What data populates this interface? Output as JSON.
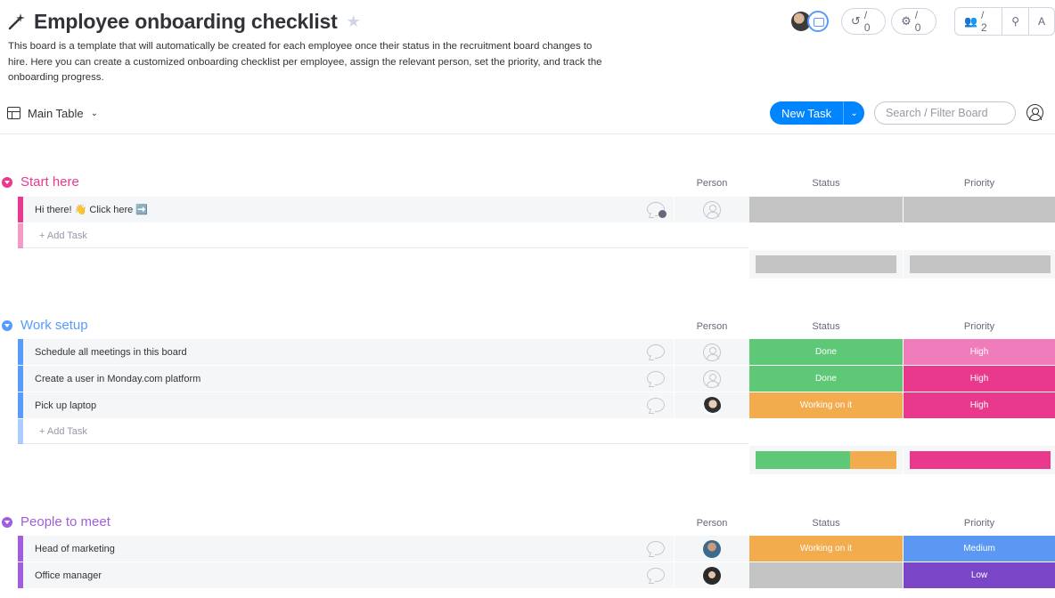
{
  "board": {
    "title": "Employee onboarding checklist",
    "description": "This board is a template that will automatically be created for each employee once their status in the recruitment board changes to hire. Here you can create a customized onboarding checklist per employee, assign the relevant person, set the priority, and track the onboarding progress."
  },
  "header_actions": {
    "activity_count": "/ 0",
    "automations_count": "/ 0",
    "members_count": "/ 2",
    "trailing_letter": "A"
  },
  "view": {
    "name": "Main Table",
    "new_task_label": "New Task",
    "search_placeholder": "Search / Filter Board"
  },
  "columns": {
    "person": "Person",
    "status": "Status",
    "priority": "Priority"
  },
  "add_task_placeholder": "+ Add Task",
  "colors": {
    "done": "#5ec877",
    "working": "#f2ac4e",
    "empty": "#c4c4c4",
    "high_light": "#f07cbc",
    "high": "#e8398c",
    "medium": "#5b98f4",
    "low": "#7b45c8",
    "group_start": "#e8398c",
    "group_work": "#579bfc",
    "group_people": "#a25ddc"
  },
  "groups": [
    {
      "title": "Start here",
      "items": [
        {
          "name": "Hi there! 👋 Click here ➡️",
          "status": "",
          "priority": ""
        }
      ]
    },
    {
      "title": "Work setup",
      "items": [
        {
          "name": "Schedule all meetings in this board",
          "status": "Done",
          "priority": "High"
        },
        {
          "name": "Create a user in Monday.com platform",
          "status": "Done",
          "priority": "High"
        },
        {
          "name": "Pick up laptop",
          "status": "Working on it",
          "priority": "High"
        }
      ]
    },
    {
      "title": "People to meet",
      "items": [
        {
          "name": "Head of marketing",
          "status": "Working on it",
          "priority": "Medium"
        },
        {
          "name": "Office manager",
          "status": "",
          "priority": "Low"
        }
      ]
    }
  ]
}
